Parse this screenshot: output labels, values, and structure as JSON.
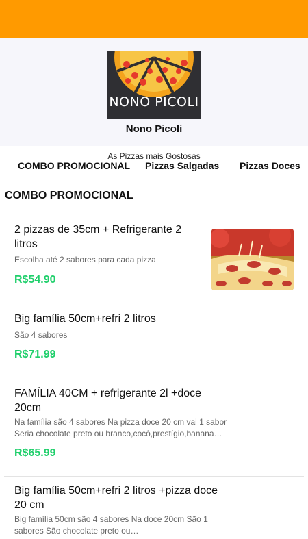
{
  "brand": {
    "logo_text": "NONO PICOLI",
    "name": "Nono Picoli",
    "tagline": "As Pizzas mais Gostosas",
    "accent_color": "#ff9a00",
    "price_color": "#1fcf6b"
  },
  "tabs": [
    {
      "label": "COMBO PROMOCIONAL"
    },
    {
      "label": "Pizzas Salgadas"
    },
    {
      "label": "Pizzas Doces"
    }
  ],
  "section": {
    "title": "COMBO PROMOCIONAL"
  },
  "items": [
    {
      "title": "2 pizzas de 35cm + Refrigerante 2 litros",
      "description": "Escolha até 2 sabores para cada pizza",
      "price": "R$54.90",
      "image_icon": "pizza-photo"
    },
    {
      "title": "Big família 50cm+refri 2 litros",
      "description": "São 4 sabores",
      "price": "R$71.99"
    },
    {
      "title": "FAMÍLIA 40CM + refrigerante 2l +doce 20cm",
      "description": "Na família são 4 sabores Na pizza doce 20 cm vai 1 sabor Seria chocolate preto ou branco,cocô,prestígio,banana…",
      "price": "R$65.99"
    },
    {
      "title": "Big família 50cm+refri 2 litros +pizza doce 20 cm",
      "description": "Big família 50cm são 4 sabores Na doce 20cm São 1 sabores São chocolate preto ou…"
    }
  ]
}
